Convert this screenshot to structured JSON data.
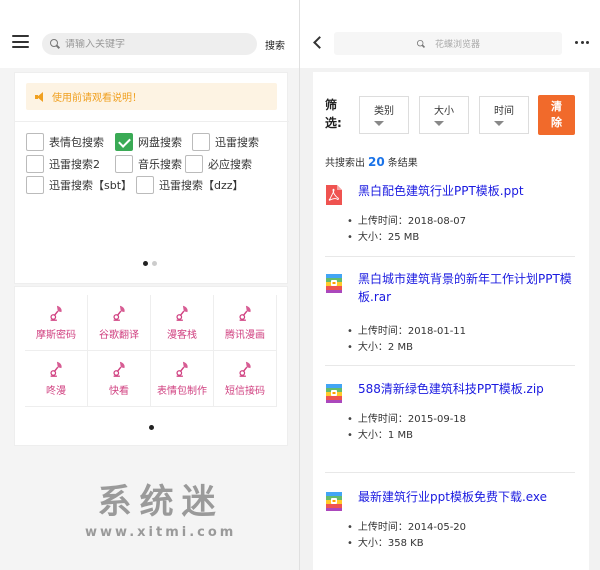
{
  "left": {
    "search": {
      "placeholder": "请输入关键字",
      "button": "搜索"
    },
    "notice": "使用前请观看说明！",
    "options": [
      {
        "label": "表情包搜索",
        "checked": false
      },
      {
        "label": "网盘搜索",
        "checked": true
      },
      {
        "label": "迅雷搜索",
        "checked": false
      },
      {
        "label": "迅雷搜索2",
        "checked": false
      },
      {
        "label": "音乐搜索",
        "checked": false
      },
      {
        "label": "必应搜索",
        "checked": false
      },
      {
        "label": "迅雷搜索【sbt】",
        "checked": false
      },
      {
        "label": "迅雷搜索【dzz】",
        "checked": false
      }
    ],
    "tools": [
      "摩斯密码",
      "谷歌翻译",
      "漫客栈",
      "腾讯漫画",
      "咚漫",
      "快看",
      "表情包制作",
      "短信接码"
    ],
    "tool_icon": "gramophone-icon",
    "accent_color": "#d04080"
  },
  "watermark": {
    "cn": "系统迷",
    "url": "www.xitmi.com"
  },
  "right": {
    "url_bar": "花蝶浏览器",
    "filter": {
      "label": "筛选:",
      "selects": [
        "类别",
        "大小",
        "时间"
      ],
      "clear": "清除"
    },
    "count": {
      "prefix": "共搜索出",
      "value": "20",
      "suffix": "条结果"
    },
    "results": [
      {
        "type": "pdf",
        "title": "黑白配色建筑行业PPT模板.ppt",
        "upload": "上传时间：2018-08-07",
        "size": "大小：25 MB"
      },
      {
        "type": "archive",
        "title": "黑白城市建筑背景的新年工作计划PPT模板.rar",
        "upload": "上传时间：2018-01-11",
        "size": "大小：2 MB"
      },
      {
        "type": "archive",
        "title": "588清新绿色建筑科技PPT模板.zip",
        "upload": "上传时间：2015-09-18",
        "size": "大小：1 MB"
      },
      {
        "type": "archive",
        "title": "最新建筑行业ppt模板免费下载.exe",
        "upload": "上传时间：2014-05-20",
        "size": "大小：358 KB"
      }
    ],
    "accent_color": "#1a1ae0",
    "clear_color": "#f16a2b"
  }
}
